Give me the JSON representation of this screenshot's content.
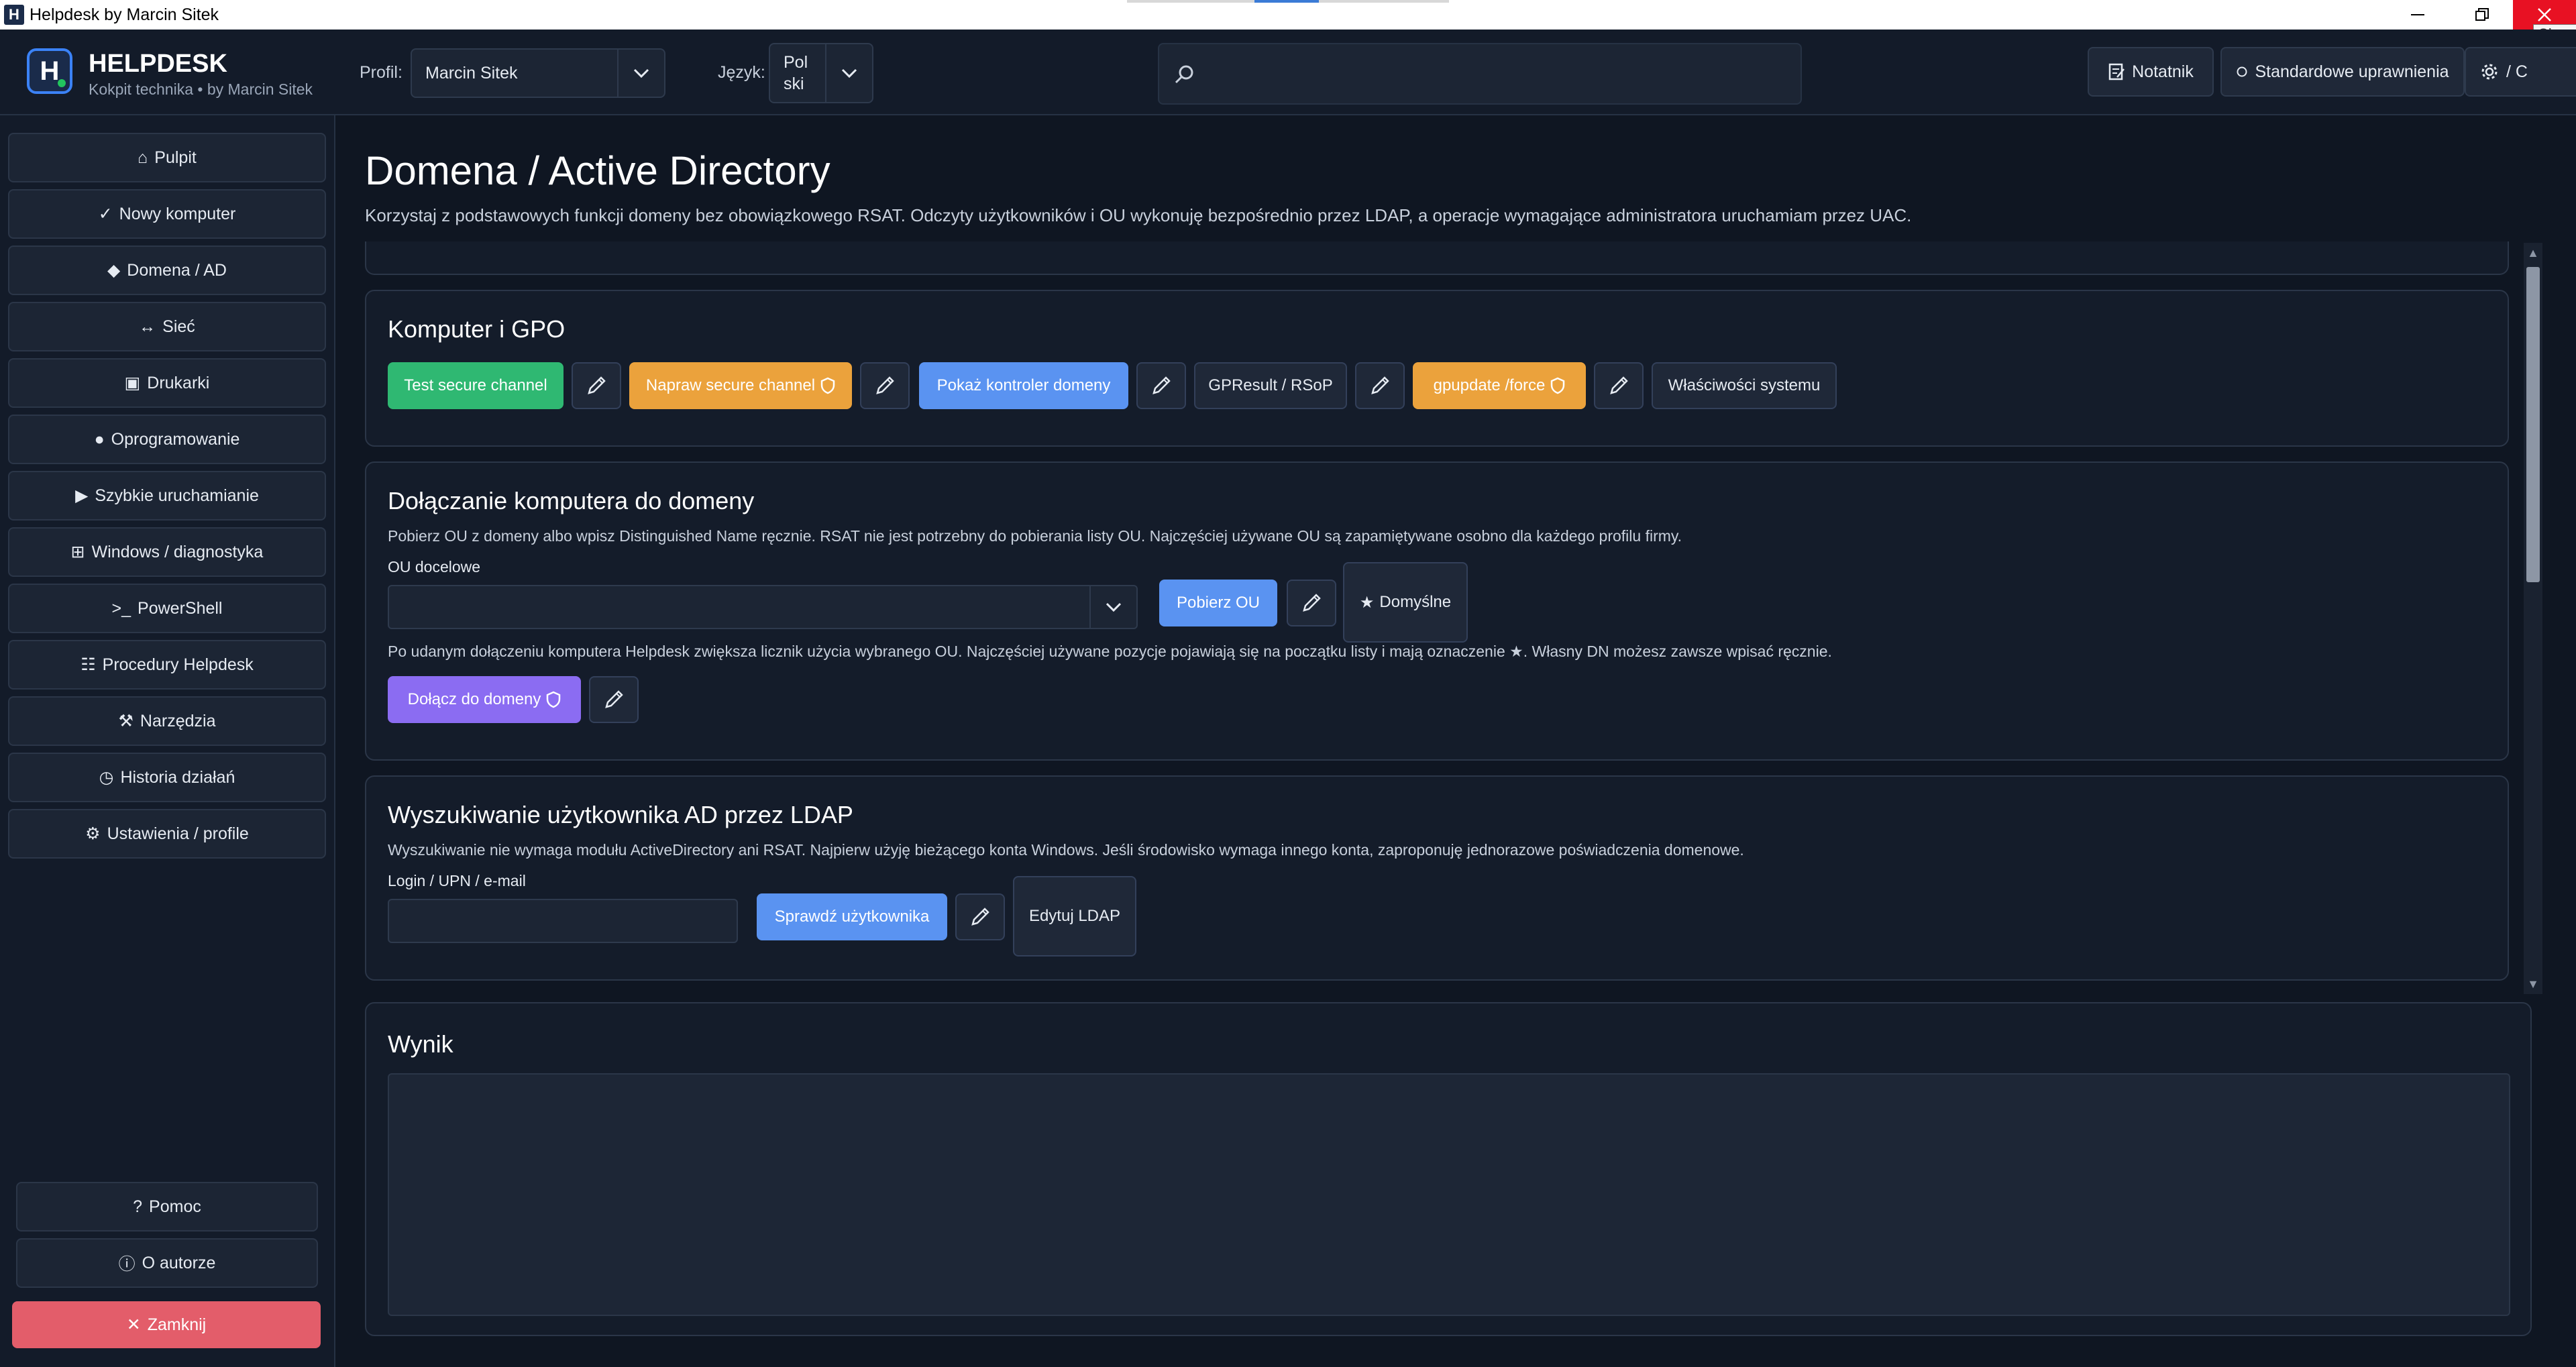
{
  "window": {
    "title": "Helpdesk by Marcin Sitek",
    "app_icon": "H",
    "close_tooltip": "Close"
  },
  "header": {
    "brand_title": "HELPDESK",
    "brand_subtitle": "Kokpit technika • by Marcin Sitek",
    "profile_label": "Profil:",
    "profile_value": "Marcin Sitek",
    "language_label": "Język:",
    "language_value_line1": "Pol",
    "language_value_line2": "ski",
    "search_placeholder": "",
    "notebook_label": "Notatnik",
    "permissions_label": "Standardowe uprawnienia",
    "theme_label": "/ C"
  },
  "sidebar": {
    "items": [
      {
        "icon": "⌂",
        "label": "Pulpit"
      },
      {
        "icon": "✓",
        "label": "Nowy komputer"
      },
      {
        "icon": "◆",
        "label": "Domena / AD"
      },
      {
        "icon": "↔",
        "label": "Sieć"
      },
      {
        "icon": "▣",
        "label": "Drukarki"
      },
      {
        "icon": "●",
        "label": "Oprogramowanie"
      },
      {
        "icon": "▶",
        "label": "Szybkie uruchamianie"
      },
      {
        "icon": "⊞",
        "label": "Windows / diagnostyka"
      },
      {
        "icon": ">_",
        "label": "PowerShell"
      },
      {
        "icon": "☷",
        "label": "Procedury Helpdesk"
      },
      {
        "icon": "⚒",
        "label": "Narzędzia"
      },
      {
        "icon": "◷",
        "label": "Historia działań"
      },
      {
        "icon": "⚙",
        "label": "Ustawienia / profile"
      }
    ],
    "help_label": "Pomoc",
    "help_icon": "?",
    "about_label": "O autorze",
    "about_icon": "ⓘ",
    "close_label": "Zamknij",
    "close_icon": "✕"
  },
  "page": {
    "title": "Domena / Active Directory",
    "description": "Korzystaj z podstawowych funkcji domeny bez obowiązkowego RSAT. Odczyty użytkowników i OU wykonuję bezpośrednio przez LDAP, a operacje wymagające administratora uruchamiam przez UAC."
  },
  "gpo": {
    "title": "Komputer i GPO",
    "test_secure_channel": "Test secure channel",
    "repair_secure_channel": "Napraw secure channel",
    "show_dc": "Pokaż kontroler domeny",
    "gpresult": "GPResult / RSoP",
    "gpupdate": "gpupdate /force",
    "system_properties": "Właściwości systemu"
  },
  "join": {
    "title": "Dołączanie komputera do domeny",
    "description": "Pobierz OU z domeny albo wpisz Distinguished Name ręcznie. RSAT nie jest potrzebny do pobierania listy OU. Najczęściej używane OU są zapamiętywane osobno dla każdego profilu firmy.",
    "ou_label": "OU docelowe",
    "ou_value": "",
    "fetch_ou": "Pobierz OU",
    "default_label": "Domyślne",
    "hint": "Po udanym dołączeniu komputera Helpdesk zwiększa licznik użycia wybranego OU. Najczęściej używane pozycje pojawiają się na początku listy i mają oznaczenie ★. Własny DN możesz zawsze wpisać ręcznie.",
    "join_button": "Dołącz do domeny"
  },
  "ldap": {
    "title": "Wyszukiwanie użytkownika AD przez LDAP",
    "description": "Wyszukiwanie nie wymaga modułu ActiveDirectory ani RSAT. Najpierw użyję bieżącego konta Windows. Jeśli środowisko wymaga innego konta, zaproponuję jednorazowe poświadczenia domenowe.",
    "login_label": "Login / UPN / e-mail",
    "login_value": "",
    "check_user": "Sprawdź użytkownika",
    "edit_ldap": "Edytuj LDAP"
  },
  "result": {
    "title": "Wynik",
    "content": ""
  },
  "colors": {
    "green": "#2fb872",
    "orange": "#eba23c",
    "blue": "#5a93f1",
    "purple": "#8b6cf2",
    "danger": "#e35d6a",
    "accent": "#3b82f6"
  }
}
